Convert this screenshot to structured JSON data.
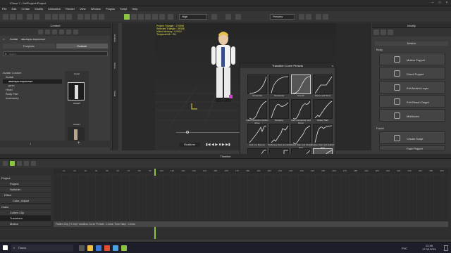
{
  "window": {
    "title": "iClone 7 - DefProject.iProject"
  },
  "menu": [
    "File",
    "Edit",
    "Create",
    "Modify",
    "Animation",
    "Render",
    "View",
    "Window",
    "Plugins",
    "Script",
    "Help"
  ],
  "toolbar": {
    "quality": "High",
    "preview": "Preview"
  },
  "content": {
    "title": "Content",
    "path": "Avatar",
    "path2": "аватары взрослые",
    "tabs": [
      "Template",
      "Custom"
    ],
    "search_placeholder": "Search",
    "tree": [
      "Avatar Custom",
      "Avatar",
      "аватары взрослые",
      "дети",
      "Head",
      "Body Part",
      "Accessory"
    ],
    "thumbs": [
      "Avatar",
      "Avatar5",
      "Avatar1"
    ],
    "side_tabs": [
      "Content",
      "Scene",
      "Visual"
    ]
  },
  "viewport": {
    "info": [
      "Project Triangle : 170396",
      "Selected Triangle : 59398",
      "Video Memory : 0.0/0.0",
      "Temporal AA : ON"
    ],
    "realtime": "Realtime"
  },
  "popup": {
    "title": "Transition Curve Presets",
    "items": [
      "Accelerate",
      "Decelerate",
      "Smooth",
      "Pause and Move",
      "Gain momentum before Move",
      "Damping",
      "Gain momentum and Damp",
      "Stutter Start",
      "End in a Bounce",
      "Stuttering Start and End",
      "Elastic Start and Stutter End",
      "Sudden Start with Elastic End",
      "Elastic Start and End",
      "Step",
      "Linear",
      "Custom"
    ],
    "selected": "Custom",
    "hint": "Preset"
  },
  "modify": {
    "title": "Modify",
    "subtitle": "Motion",
    "section1": "Body",
    "section2": "Facial",
    "items": [
      "Motion Puppet",
      "Direct Puppet",
      "Edit Motion Layer",
      "Edit Reach Target",
      "MixMoves",
      "Create Script",
      "Face Puppet"
    ]
  },
  "timeline": {
    "title": "Timeline",
    "rows": [
      "Project",
      "Project",
      "Switcher",
      "Effect",
      "Color_Adjust",
      "Claire",
      "Collect Clip",
      "Transform",
      "Motion"
    ],
    "status": "Flatten Clip (+1.00) Transition Curve Presets : Linear, Time Warp : Linear",
    "ruler": [
      "10",
      "20",
      "30",
      "40",
      "50",
      "60",
      "70",
      "80",
      "90",
      "100",
      "110",
      "120",
      "130",
      "140",
      "150",
      "160",
      "170",
      "180",
      "190",
      "200",
      "210",
      "220",
      "230",
      "240",
      "250",
      "260",
      "270",
      "280",
      "290",
      "300",
      "310",
      "320",
      "330",
      "340",
      "350",
      "360"
    ]
  },
  "taskbar": {
    "search": "Поиск",
    "lang": "РУС",
    "time": "22:46",
    "date": "17.03.2021"
  },
  "accent": "#8bc53f"
}
